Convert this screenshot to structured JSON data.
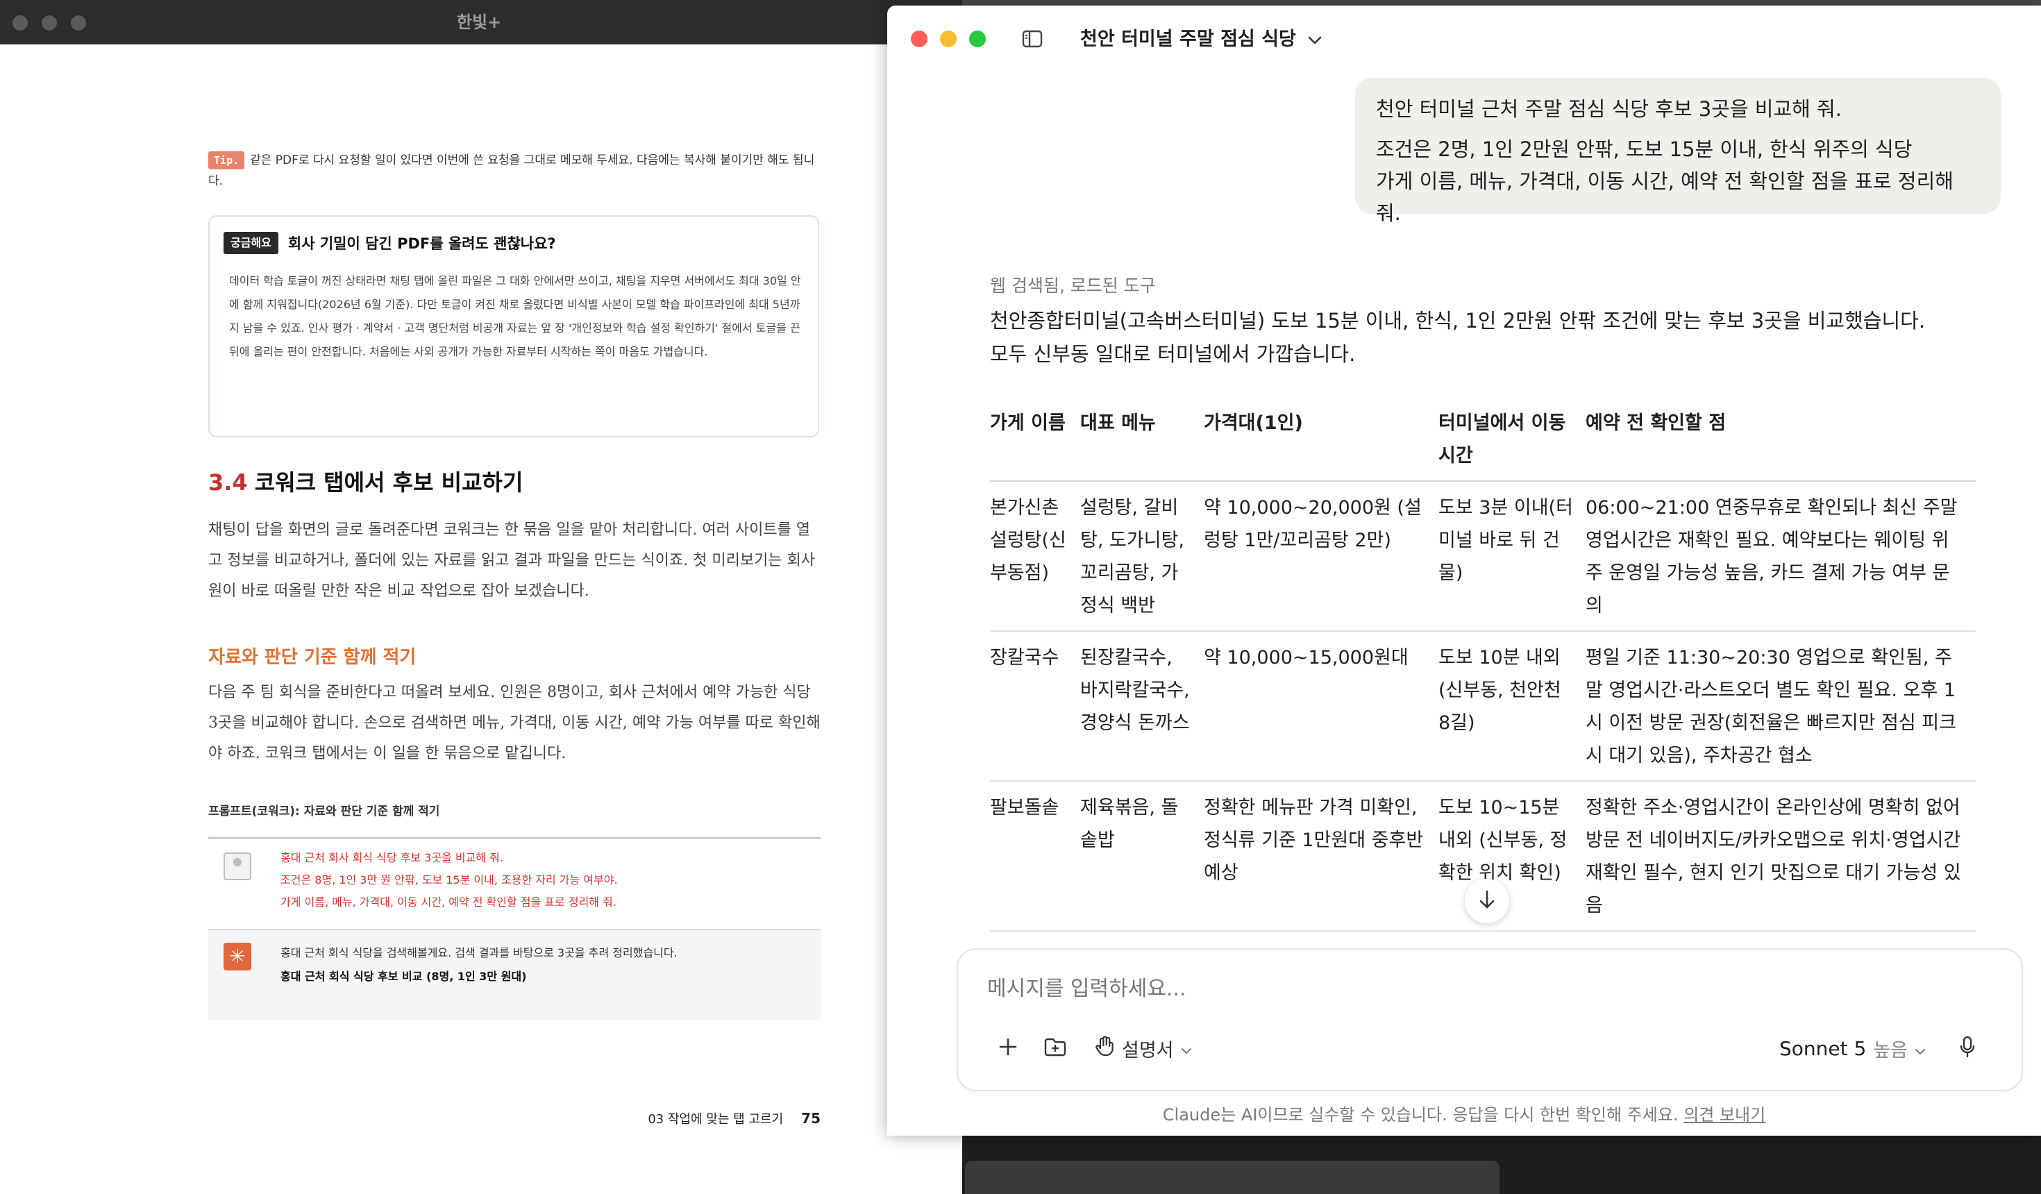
{
  "reader": {
    "window_title": "한빛+",
    "tip_badge": "Tip.",
    "tip_text": "같은 PDF로 다시 요청할 일이 있다면 이번에 쓴 요청을 그대로 메모해 두세요. 다음에는 복사해 붙이기만 해도 됩니다.",
    "faq_badge": "궁금해요",
    "faq_title": "회사 기밀이 담긴 PDF를 올려도 괜찮나요?",
    "faq_body": "데이터 학습 토글이 꺼진 상태라면 채팅 탭에 올린 파일은 그 대화 안에서만 쓰이고, 채팅을 지우면 서버에서도 최대 30일 안에 함께 지워집니다(2026년 6월 기준). 다만 토글이 켜진 채로 올렸다면 비식별 사본이 모델 학습 파이프라인에 최대 5년까지 남을 수 있죠. 인사 평가 · 계약서 · 고객 명단처럼 비공개 자료는 앞 장 '개인정보와 학습 설정 확인하기' 절에서 토글을 끈 뒤에 올리는 편이 안전합니다. 처음에는 사외 공개가 가능한 자료부터 시작하는 쪽이 마음도 가볍습니다.",
    "section_number": "3.4",
    "section_title": "코워크 탭에서 후보 비교하기",
    "section_para": "채팅이 답을 화면의 글로 돌려준다면 코워크는 한 묶음 일을 맡아 처리합니다. 여러 사이트를 열고 정보를 비교하거나, 폴더에 있는 자료를 읽고 결과 파일을 만드는 식이죠. 첫 미리보기는 회사원이 바로 떠올릴 만한 작은 비교 작업으로 잡아 보겠습니다.",
    "subsection_title": "자료와 판단 기준 함께 적기",
    "subsection_para": "다음 주 팀 회식을 준비한다고 떠올려 보세요. 인원은 8명이고, 회사 근처에서 예약 가능한 식당 3곳을 비교해야 합니다. 손으로 검색하면 메뉴, 가격대, 이동 시간, 예약 가능 여부를 따로 확인해야 하죠. 코워크 탭에서는 이 일을 한 묶음으로 맡깁니다.",
    "prompt_caption": "프롬프트(코워크): 자료와 판단 기준 함께 적기",
    "prompt_user_lines": [
      "홍대 근처 회사 회식 식당 후보 3곳을 비교해 줘.",
      "조건은 8명, 1인 3만 원 안팎, 도보 15분 이내, 조용한 자리 가능 여부야.",
      "가게 이름, 메뉴, 가격대, 이동 시간, 예약 전 확인할 점을 표로 정리해 줘."
    ],
    "prompt_assistant_line": "홍대 근처 회식 식당을 검색해볼게요. 검색 결과를 바탕으로 3곳을 추려 정리했습니다.",
    "prompt_assistant_bold": "홍대 근처 회식 식당 후보 비교 (8명, 1인 3만 원대)",
    "footer_chapter": "03 작업에 맞는 탭 고르기",
    "footer_page": "75"
  },
  "chat": {
    "title": "천안 터미널 주말 점심 식당",
    "user_message": [
      "천안 터미널 근처 주말 점심 식당 후보 3곳을 비교해 줘.",
      "조건은 2명, 1인 2만원 안팎, 도보 15분 이내, 한식 위주의 식당\n가게 이름, 메뉴, 가격대, 이동 시간, 예약 전 확인할 점을 표로 정리해 줘."
    ],
    "tools_used": "웹 검색됨, 로드된 도구",
    "answer_intro": "천안종합터미널(고속버스터미널) 도보 15분 이내, 한식, 1인 2만원 안팎 조건에 맞는 후보 3곳을 비교했습니다. 모두 신부동 일대로 터미널에서 가깝습니다.",
    "table": {
      "headers": [
        "가게 이름",
        "대표 메뉴",
        "가격대(1인)",
        "터미널에서 이동 시간",
        "예약 전 확인할 점"
      ],
      "rows": [
        [
          "본가신촌설렁탕(신부동점)",
          "설렁탕, 갈비탕, 도가니탕, 꼬리곰탕, 가정식 백반",
          "약 10,000~20,000원 (설렁탕 1만/꼬리곰탕 2만)",
          "도보 3분 이내(터미널 바로 뒤 건물)",
          "06:00~21:00 연중무휴로 확인되나 최신 주말 영업시간은 재확인 필요. 예약보다는 웨이팅 위주 운영일 가능성 높음, 카드 결제 가능 여부 문의"
        ],
        [
          "장칼국수",
          "된장칼국수, 바지락칼국수, 경양식 돈까스",
          "약 10,000~15,000원대",
          "도보 10분 내외(신부동, 천안천 8길)",
          "평일 기준 11:30~20:30 영업으로 확인됨, 주말 영업시간·라스트오더 별도 확인 필요. 오후 1시 이전 방문 권장(회전율은 빠르지만 점심 피크 시 대기 있음), 주차공간 협소"
        ],
        [
          "팔보돌솥",
          "제육볶음, 돌솥밥",
          "정확한 메뉴판 가격 미확인, 정식류 기준 1만원대 중후반 예상",
          "도보 10~15분 내외 (신부동, 정확한 위치 확인)",
          "정확한 주소·영업시간이 온라인상에 명확히 없어 방문 전 네이버지도/카카오맵으로 위치·영업시간 재확인 필수, 현지 인기 맛집으로 대기 가능성 있음"
        ]
      ]
    },
    "composer": {
      "placeholder": "메시지를 입력하세요...",
      "style_label": "설명서",
      "model_name": "Sonnet 5",
      "effort_label": "높음"
    },
    "disclaimer": "Claude는 AI이므로 실수할 수 있습니다. 응답을 다시 한번 확인해 주세요.",
    "feedback_link": "의견 보내기"
  }
}
